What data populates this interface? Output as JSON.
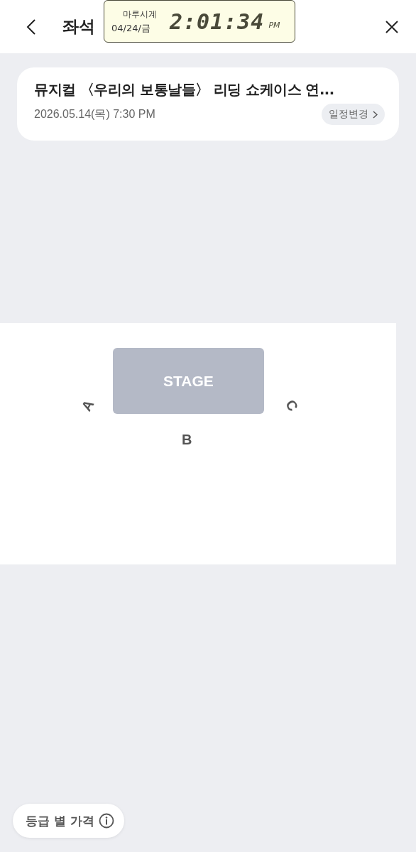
{
  "header": {
    "title": "좌석"
  },
  "clock_widget": {
    "label": "마루시계",
    "date": "04/24/금",
    "time": "2:01:34",
    "meridiem": "PM"
  },
  "event": {
    "title": "뮤지컬 〈우리의 보통날들〉 리딩 쇼케이스 연...",
    "datetime": "2026.05.14(목) 7:30 PM",
    "change_button": "일정변경"
  },
  "seat_map": {
    "stage": "STAGE",
    "sections": [
      {
        "label": "A",
        "kind": "left"
      },
      {
        "label": "B",
        "kind": "bottom"
      },
      {
        "label": "C",
        "kind": "right"
      }
    ]
  },
  "price_button": "등급 별 가격"
}
